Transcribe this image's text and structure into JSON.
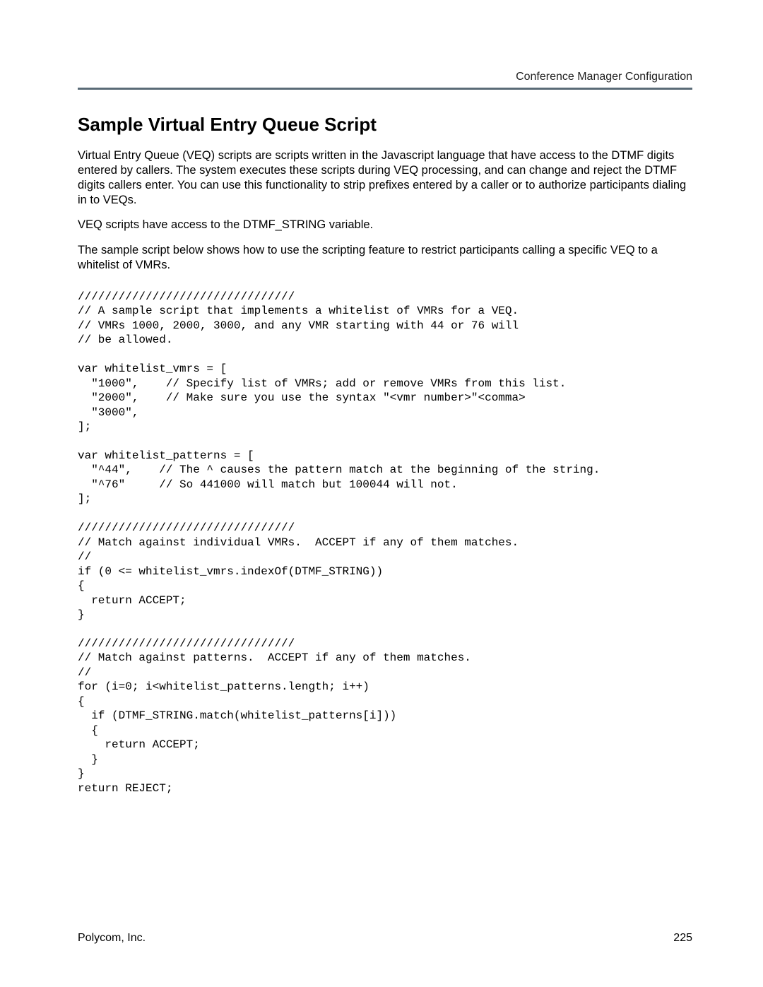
{
  "header": {
    "running_head": "Conference Manager Configuration"
  },
  "section": {
    "title": "Sample Virtual Entry Queue Script",
    "para1": "Virtual Entry Queue (VEQ) scripts are scripts written in the Javascript language that have access to the DTMF digits entered by callers. The system executes these scripts during VEQ processing, and can change and reject the DTMF digits callers enter. You can use this functionality to strip prefixes entered by a caller or to authorize participants dialing in to VEQs.",
    "para2": "VEQ scripts have access to the DTMF_STRING variable.",
    "para3": "The sample script below shows how to use the scripting feature to restrict participants calling a specific VEQ to a whitelist of VMRs."
  },
  "code": "////////////////////////////////\n// A sample script that implements a whitelist of VMRs for a VEQ.\n// VMRs 1000, 2000, 3000, and any VMR starting with 44 or 76 will\n// be allowed.\n\nvar whitelist_vmrs = [\n  \"1000\",    // Specify list of VMRs; add or remove VMRs from this list.\n  \"2000\",    // Make sure you use the syntax \"<vmr number>\"<comma>\n  \"3000\",\n];\n\nvar whitelist_patterns = [\n  \"^44\",    // The ^ causes the pattern match at the beginning of the string.\n  \"^76\"     // So 441000 will match but 100044 will not.\n];\n\n////////////////////////////////\n// Match against individual VMRs.  ACCEPT if any of them matches.\n//\nif (0 <= whitelist_vmrs.indexOf(DTMF_STRING))\n{\n  return ACCEPT;\n}\n\n////////////////////////////////\n// Match against patterns.  ACCEPT if any of them matches.\n//\nfor (i=0; i<whitelist_patterns.length; i++)\n{\n  if (DTMF_STRING.match(whitelist_patterns[i]))\n  {\n    return ACCEPT;\n  }\n}\nreturn REJECT;",
  "footer": {
    "left": "Polycom, Inc.",
    "right": "225"
  }
}
